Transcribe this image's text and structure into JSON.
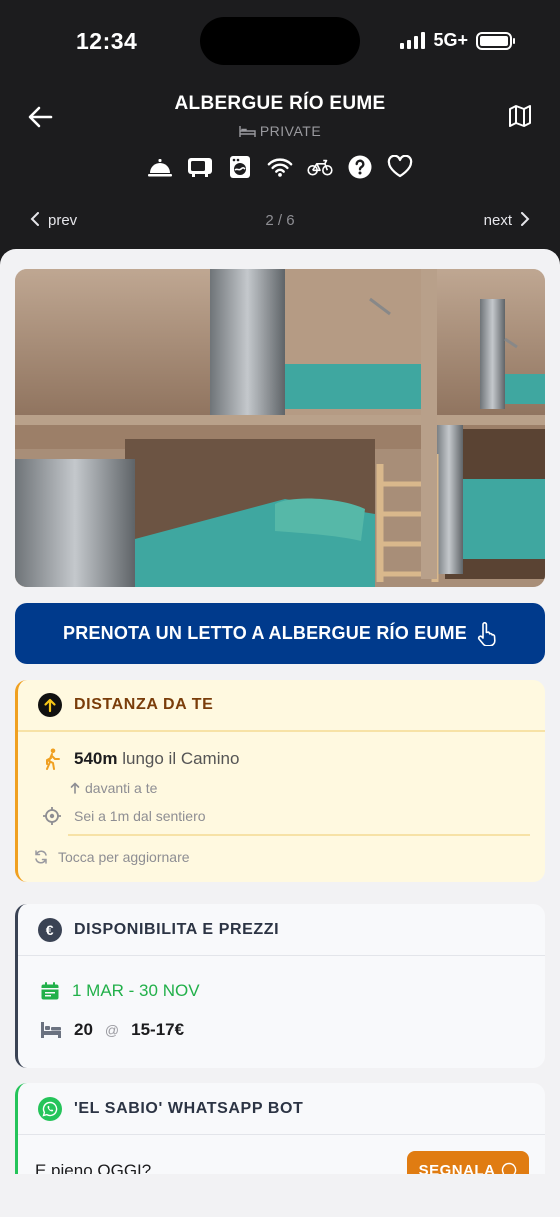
{
  "status_bar": {
    "time": "12:34",
    "network": "5G+"
  },
  "header": {
    "title": "ALBERGUE RÍO EUME",
    "type": "PRIVATE",
    "amenity_icons": [
      "reception-bell-icon",
      "microwave-icon",
      "washing-machine-icon",
      "wifi-icon",
      "bicycle-icon",
      "help-icon",
      "heart-icon"
    ],
    "prev_label": "prev",
    "next_label": "next",
    "pager": "2 / 6"
  },
  "book_button": {
    "label": "PRENOTA UN LETTO A ALBERGUE RÍO EUME"
  },
  "distance_card": {
    "title": "DISTANZA DA TE",
    "distance": "540m",
    "distance_suffix": "lungo il Camino",
    "direction": "davanti a te",
    "trail_offset": "Sei a 1m dal sentiero",
    "refresh": "Tocca per aggiornare",
    "accent": "#f0a020"
  },
  "availability_card": {
    "title": "DISPONIBILITA E PREZZI",
    "dates": "1 MAR - 30 NOV",
    "beds": "20",
    "at": "@",
    "price": "15-17€",
    "accent": "#3a4354"
  },
  "whatsapp_card": {
    "title": "'EL SABIO' WHATSAPP BOT",
    "question": "E pieno OGGI?",
    "report_label": "SEGNALA",
    "accent": "#25c45a"
  },
  "colors": {
    "header_bg": "#1c1c1e",
    "book_button": "#003a8c",
    "report_button": "#e07c12"
  }
}
